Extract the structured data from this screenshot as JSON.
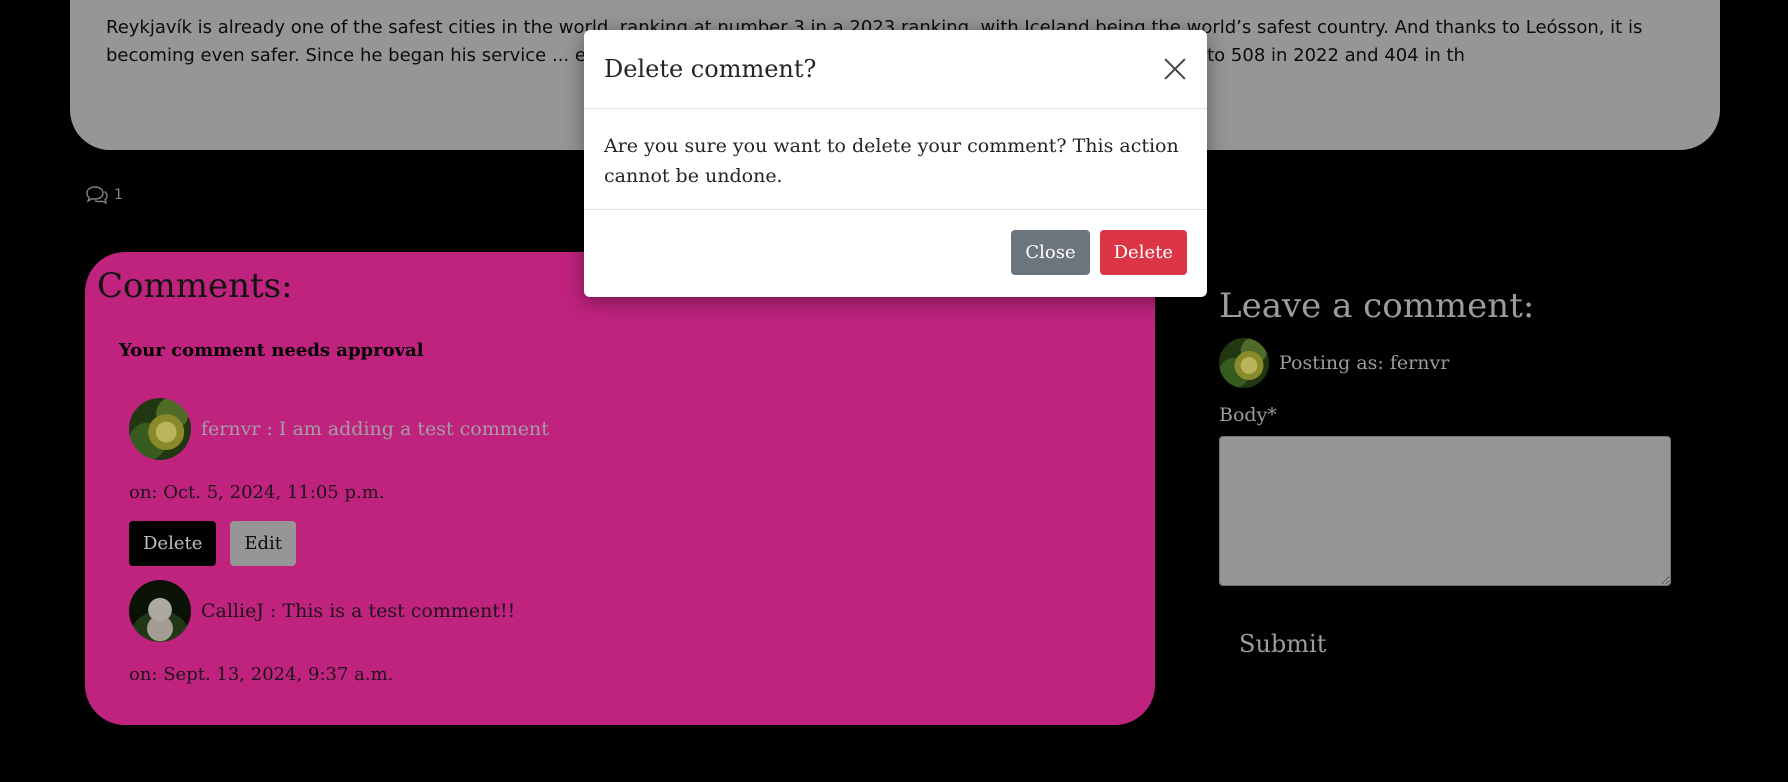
{
  "article": {
    "text": "Reykjavík is already one of the safest cities in the world, ranking at number 3 in a 2023 ranking, with Iceland being the world’s safest country. And thanks to Leósson, it is becoming even safer. Since he began his service ... en its rate of bike thefts drop significantly. Theft fell from 569 in 2021 to 508 in 2022 and 404 in th"
  },
  "comment_count": {
    "value": "1",
    "icon": "comments-icon"
  },
  "comments_panel": {
    "title": "Comments:",
    "approval_note": "Your comment needs approval",
    "comments": [
      {
        "author": "fernvr",
        "text": "I am adding a test comment",
        "author_line": "fernvr :  I am adding a test comment",
        "date": "on: Oct. 5, 2024, 11:05 p.m.",
        "delete_label": "Delete",
        "edit_label": "Edit"
      },
      {
        "author": "CallieJ",
        "text": "This is a test comment!!",
        "author_line": "CallieJ :  This is a test comment!!",
        "date": "on: Sept. 13, 2024, 9:37 a.m."
      }
    ]
  },
  "leave_comment": {
    "title": "Leave a comment:",
    "posting_as": "Posting as: fernvr",
    "body_label": "Body*",
    "body_value": "",
    "submit_label": "Submit"
  },
  "modal": {
    "title": "Delete comment?",
    "body": "Are you sure you want to delete your comment? This action cannot be undone.",
    "close_label": "Close",
    "delete_label": "Delete"
  },
  "colors": {
    "comments_panel_bg": "#ff2fa9",
    "danger": "#dc3545",
    "secondary": "#6c757d"
  }
}
